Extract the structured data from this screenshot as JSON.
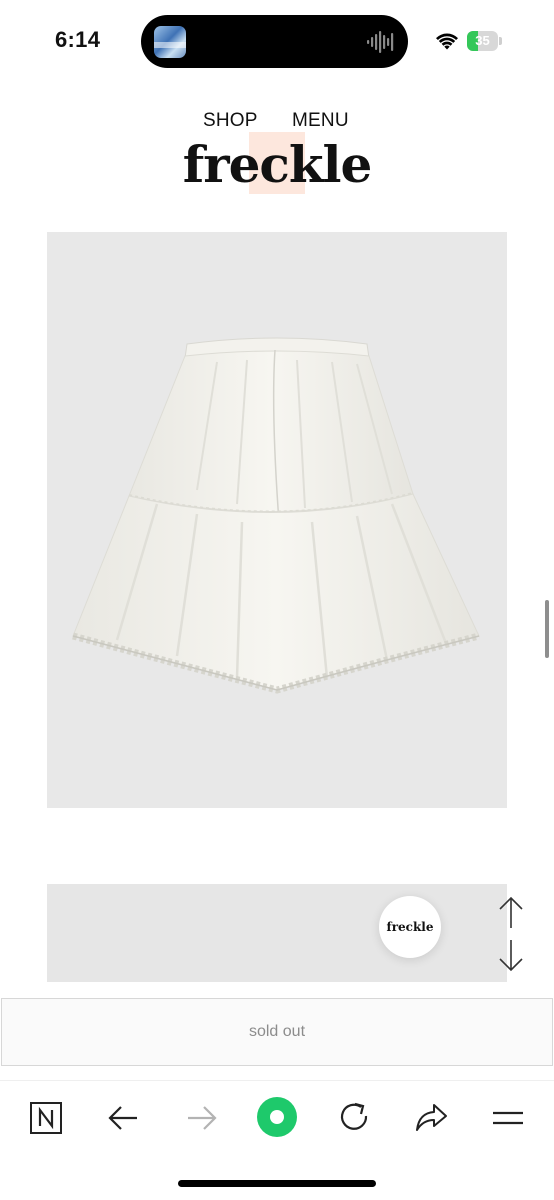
{
  "status_bar": {
    "time": "6:14",
    "battery_level": "35",
    "battery_fraction": 0.35,
    "icons": [
      "island-thumbnail",
      "audio-waveform-icon",
      "wifi-icon",
      "battery-icon"
    ]
  },
  "site": {
    "nav_shop": "SHOP",
    "nav_menu": "MENU",
    "brand": "freckle"
  },
  "product": {
    "image_subject": "white tiered lace-trim skirt",
    "image_background": "#e8e8e8"
  },
  "floating": {
    "chip_label": "freckle",
    "icons": [
      "arrow-up-icon",
      "arrow-down-icon"
    ]
  },
  "purchase": {
    "sold_out_label": "sold out"
  },
  "browser_toolbar": {
    "items": [
      "naver-home-icon",
      "back-arrow-icon",
      "forward-arrow-icon",
      "green-dot-icon",
      "reload-icon",
      "share-icon",
      "menu-icon"
    ],
    "accent_color": "#1ec96b"
  },
  "colors": {
    "text": "#111111",
    "muted": "#8c8c8c",
    "battery_green": "#34c759"
  }
}
